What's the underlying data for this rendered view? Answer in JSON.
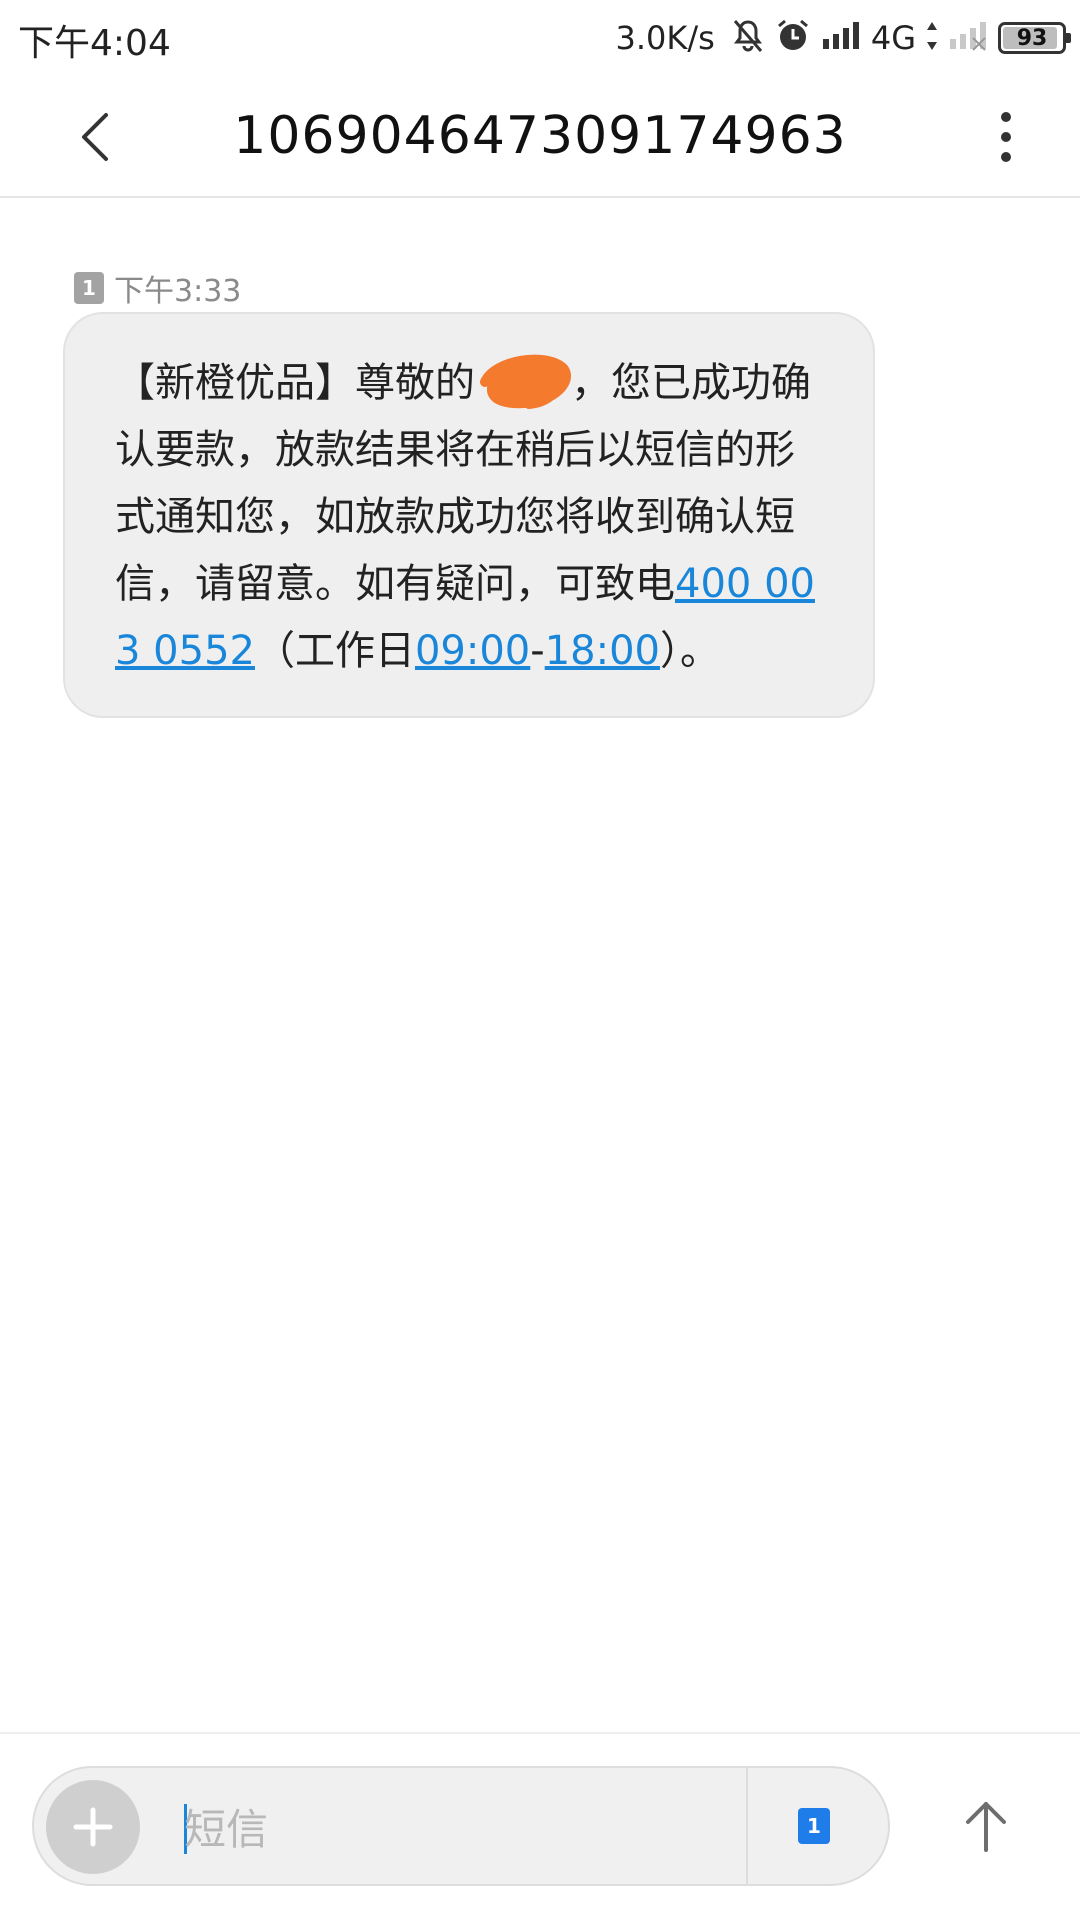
{
  "status_bar": {
    "time": "下午4:04",
    "net_speed": "3.0K/s",
    "network_type": "4G",
    "battery": "93",
    "battery_level": 0.93
  },
  "header": {
    "title": "106904647309174963"
  },
  "message": {
    "sim_label": "1",
    "time": "下午3:33",
    "text_before_redaction": "【新橙优品】尊敬的",
    "text_after_redaction": "，您已成功确认要款，放款结果将在稍后以短信的形式通知您，如放款成功您将收到确认短信，请留意。如有疑问，可致电",
    "phone_link": "400 003 0552",
    "text_workday": "（工作日",
    "time_link_start": "09:00",
    "time_dash": "-",
    "time_link_end": "18:00",
    "text_end": "）。"
  },
  "composer": {
    "placeholder": "短信",
    "sim_label": "1"
  },
  "colors": {
    "link": "#1a86d9",
    "bubble": "#efefef",
    "redaction": "#f47a2e",
    "sim_active": "#1e7de8"
  }
}
